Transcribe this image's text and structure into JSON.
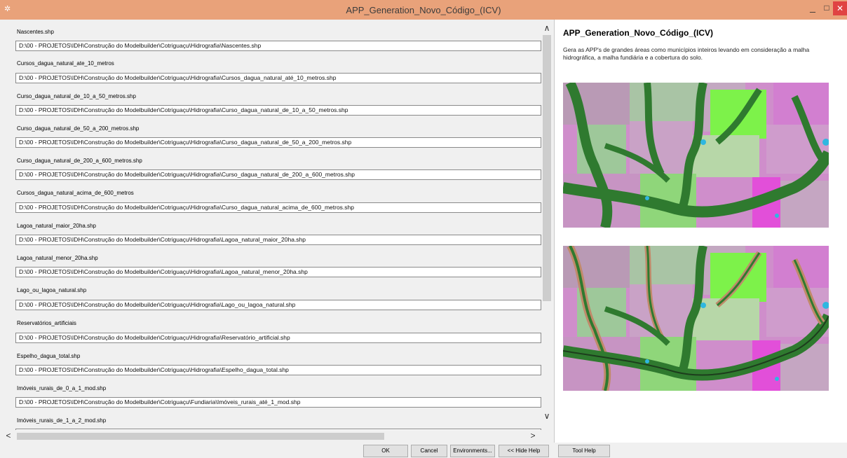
{
  "window": {
    "title": "APP_Generation_Novo_Código_(ICV)",
    "app_icon": "arcgis-tool-icon",
    "controls": {
      "minimize": "_",
      "maximize": "□",
      "close": "✕"
    }
  },
  "parameters": [
    {
      "label": "Nascentes.shp",
      "value": "D:\\00 - PROJETOS\\IDH\\Construção do Modelbuilder\\Cotriguaçu\\Hidrografia\\Nascentes.shp"
    },
    {
      "label": "Cursos_dagua_natural_ate_10_metros",
      "value": "D:\\00 - PROJETOS\\IDH\\Construção do Modelbuilder\\Cotriguaçu\\Hidrografia\\Cursos_dagua_natural_até_10_metros.shp"
    },
    {
      "label": "Curso_dagua_natural_de_10_a_50_metros.shp",
      "value": "D:\\00 - PROJETOS\\IDH\\Construção do Modelbuilder\\Cotriguaçu\\Hidrografia\\Curso_dagua_natural_de_10_a_50_metros.shp"
    },
    {
      "label": "Curso_dagua_natural_de_50_a_200_metros.shp",
      "value": "D:\\00 - PROJETOS\\IDH\\Construção do Modelbuilder\\Cotriguaçu\\Hidrografia\\Curso_dagua_natural_de_50_a_200_metros.shp"
    },
    {
      "label": "Curso_dagua_natural_de_200_a_600_metros.shp",
      "value": "D:\\00 - PROJETOS\\IDH\\Construção do Modelbuilder\\Cotriguaçu\\Hidrografia\\Curso_dagua_natural_de_200_a_600_metros.shp"
    },
    {
      "label": "Cursos_dagua_natural_acima_de_600_metros",
      "value": "D:\\00 - PROJETOS\\IDH\\Construção do Modelbuilder\\Cotriguaçu\\Hidrografia\\Curso_dagua_natural_acima_de_600_metros.shp"
    },
    {
      "label": "Lagoa_natural_maior_20ha.shp",
      "value": "D:\\00 - PROJETOS\\IDH\\Construção do Modelbuilder\\Cotriguaçu\\Hidrografia\\Lagoa_natural_maior_20ha.shp"
    },
    {
      "label": "Lagoa_natural_menor_20ha.shp",
      "value": "D:\\00 - PROJETOS\\IDH\\Construção do Modelbuilder\\Cotriguaçu\\Hidrografia\\Lagoa_natural_menor_20ha.shp"
    },
    {
      "label": "Lago_ou_lagoa_natural.shp",
      "value": "D:\\00 - PROJETOS\\IDH\\Construção do Modelbuilder\\Cotriguaçu\\Hidrografia\\Lago_ou_lagoa_natural.shp"
    },
    {
      "label": "Reservatórios_artificiais",
      "value": "D:\\00 - PROJETOS\\IDH\\Construção do Modelbuilder\\Cotriguaçu\\Hidrografia\\Reservatório_artificial.shp"
    },
    {
      "label": "Espelho_dagua_total.shp",
      "value": "D:\\00 - PROJETOS\\IDH\\Construção do Modelbuilder\\Cotriguaçu\\Hidrografia\\Espelho_dagua_total.shp"
    },
    {
      "label": "Imóveis_rurais_de_0_a_1_mod.shp",
      "value": "D:\\00 - PROJETOS\\IDH\\Construção do Modelbuilder\\Cotriguaçu\\Fundiaria\\Imóveis_rurais_até_1_mod.shp"
    },
    {
      "label": "Imóveis_rurais_de_1_a_2_mod.shp",
      "value": ""
    }
  ],
  "help": {
    "title": "APP_Generation_Novo_Código_(ICV)",
    "description": "Gera as APP's de grandes áreas como municípios inteiros levando em consideração a malha hidrográfica, a malha fundiária e a cobertura do solo."
  },
  "buttons": {
    "ok": "OK",
    "cancel": "Cancel",
    "environments": "Environments...",
    "hide_help": "<< Hide Help",
    "tool_help": "Tool Help"
  },
  "scroll": {
    "up": "∧",
    "down": "∨",
    "left": "<",
    "right": ">"
  },
  "colors": {
    "titlebar": "#e9a27a",
    "close": "#e04343",
    "vegetation": "#2f7a2f",
    "bright_green": "#7df24a",
    "pink": "#d98ad2",
    "magenta": "#e24fd9",
    "water": "#2fb7e0"
  }
}
